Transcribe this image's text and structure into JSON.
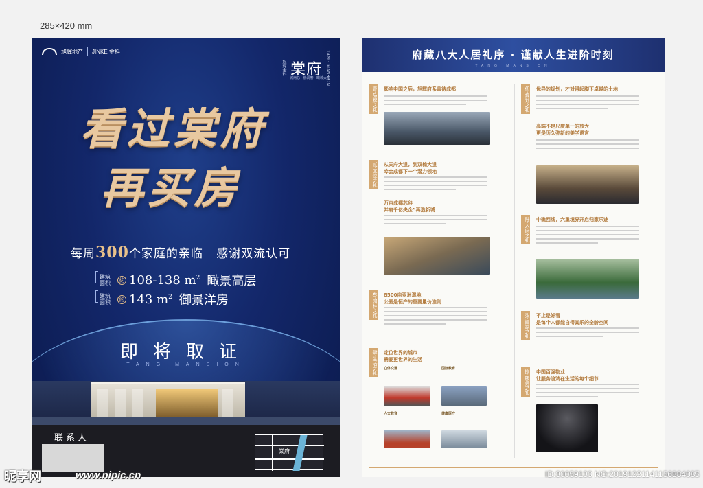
{
  "size_note": "285×420 mm",
  "left": {
    "developer": "旭辉地产",
    "partner": "JINKE 金科",
    "project_name": "棠府",
    "project_sub": "旭辉金科",
    "project_vert": "TANG MANSION",
    "tagline": "城南总 · 低调奢 · 瞰城大宅",
    "callig_line1": "看过棠府",
    "callig_line2": "再买房",
    "weekly_prefix": "每周",
    "weekly_num": "300",
    "weekly_suffix": "个家庭的亲临   感谢双流认可",
    "area1_label": "建筑面积",
    "area1_badge": "约",
    "area1_value": "108-138 m",
    "area1_sup": "2",
    "area1_desc": "瞰景高层",
    "area2_label": "建筑面积",
    "area2_badge": "约",
    "area2_value": "143 m",
    "area2_sup": "2",
    "area2_desc": "御景洋房",
    "soon": "即将取证",
    "tang_en": "TANG MANSION",
    "contact_label": "联系人",
    "map_label": "棠府"
  },
  "right": {
    "title": "府藏八大人居礼序 · 谨献人生进阶时刻",
    "subtitle_en": "TANG MANSION",
    "rites": [
      {
        "tag": "壹·品牌之礼",
        "head": "影响中国之后，旭辉府系善待成都"
      },
      {
        "tag": "贰·区位之礼",
        "head": "从天府大道，到双楠大道\n幸会成都下一个潜力领地"
      },
      {
        "tag": "",
        "head": "万亩成都芯谷\n并肩千亿央企”再造新城"
      },
      {
        "tag": "叁·园林之礼",
        "head": "8500亩亚洲湿地\n公园是恒产的重要量价准则"
      },
      {
        "tag": "肆·生活之礼",
        "head": "定位世界的城市\n需要更世界的生活"
      },
      {
        "tag": "伍·规划之礼",
        "head": "优异的规划，才对得起脚下卓越的土地"
      },
      {
        "tag": "",
        "head": "高端不是尺度单一的放大\n更是历久弥新的美学语言"
      },
      {
        "tag": "陆·入府之礼",
        "head": "中礁西线，六重境界开启归家乐途"
      },
      {
        "tag": "柒·阅家之礼",
        "head": "不止是好看\n是每个人都能自得其乐的全龄空间"
      },
      {
        "tag": "捌·服务之礼",
        "head": "中国百强物业\n让服务流淌在生活的每个细节"
      }
    ],
    "mini_captions": [
      "立体交通",
      "国际教育",
      "人文教育",
      "健康医疗"
    ]
  },
  "watermark": {
    "logo": "昵享网",
    "url": "www.nipic.cn",
    "id": "ID:30059133 NO:20191221141156884085"
  }
}
